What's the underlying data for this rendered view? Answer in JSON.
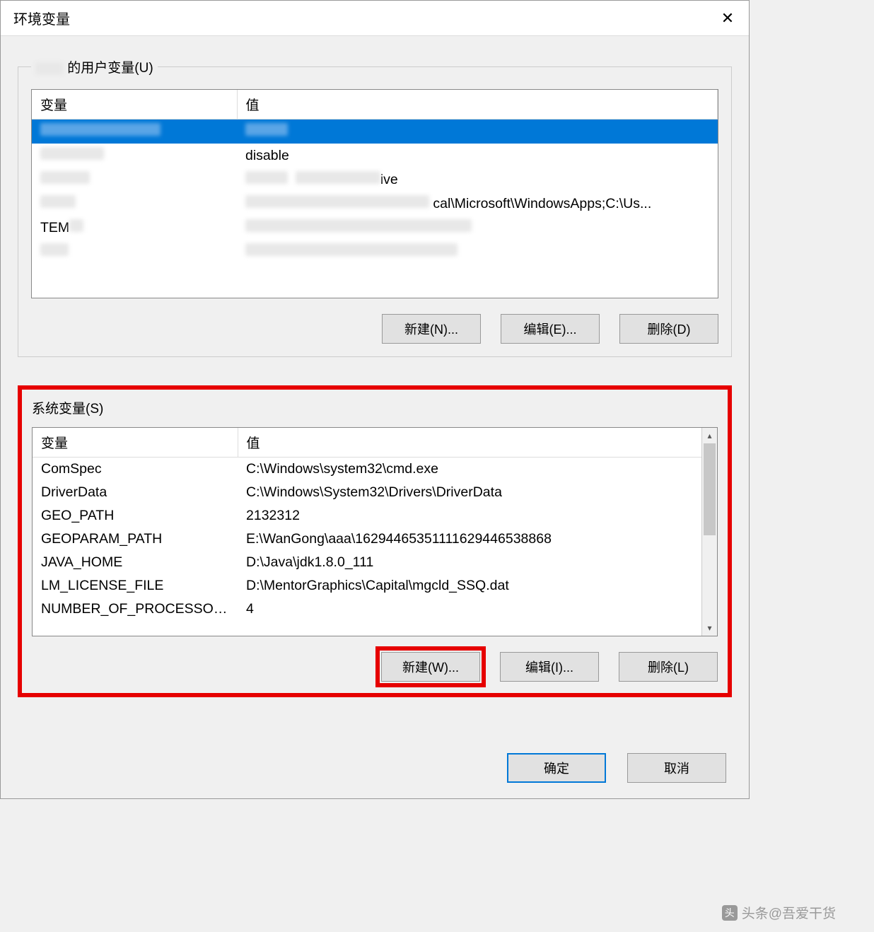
{
  "dialog": {
    "title": "环境变量"
  },
  "user_vars": {
    "legend": "的用户变量(U)",
    "header_var": "变量",
    "header_val": "值",
    "rows": [
      {
        "name": "",
        "value": ""
      },
      {
        "name": "",
        "value": "disable"
      },
      {
        "name": "",
        "value": "ive"
      },
      {
        "name": "",
        "value": "cal\\Microsoft\\WindowsApps;C:\\Us..."
      },
      {
        "name": "TEM",
        "value": ""
      },
      {
        "name": "",
        "value": ""
      }
    ],
    "buttons": {
      "new": "新建(N)...",
      "edit": "编辑(E)...",
      "delete": "删除(D)"
    }
  },
  "system_vars": {
    "legend": "系统变量(S)",
    "header_var": "变量",
    "header_val": "值",
    "rows": [
      {
        "name": "ComSpec",
        "value": "C:\\Windows\\system32\\cmd.exe"
      },
      {
        "name": "DriverData",
        "value": "C:\\Windows\\System32\\Drivers\\DriverData"
      },
      {
        "name": "GEO_PATH",
        "value": "2132312"
      },
      {
        "name": "GEOPARAM_PATH",
        "value": "E:\\WanGong\\aaa\\16294465351111629446538868"
      },
      {
        "name": "JAVA_HOME",
        "value": "D:\\Java\\jdk1.8.0_111"
      },
      {
        "name": "LM_LICENSE_FILE",
        "value": "D:\\MentorGraphics\\Capital\\mgcld_SSQ.dat"
      },
      {
        "name": "NUMBER_OF_PROCESSORS",
        "value": "4"
      }
    ],
    "buttons": {
      "new": "新建(W)...",
      "edit": "编辑(I)...",
      "delete": "删除(L)"
    }
  },
  "footer": {
    "ok": "确定",
    "cancel": "取消"
  },
  "watermark": "头条@吾爱干货"
}
